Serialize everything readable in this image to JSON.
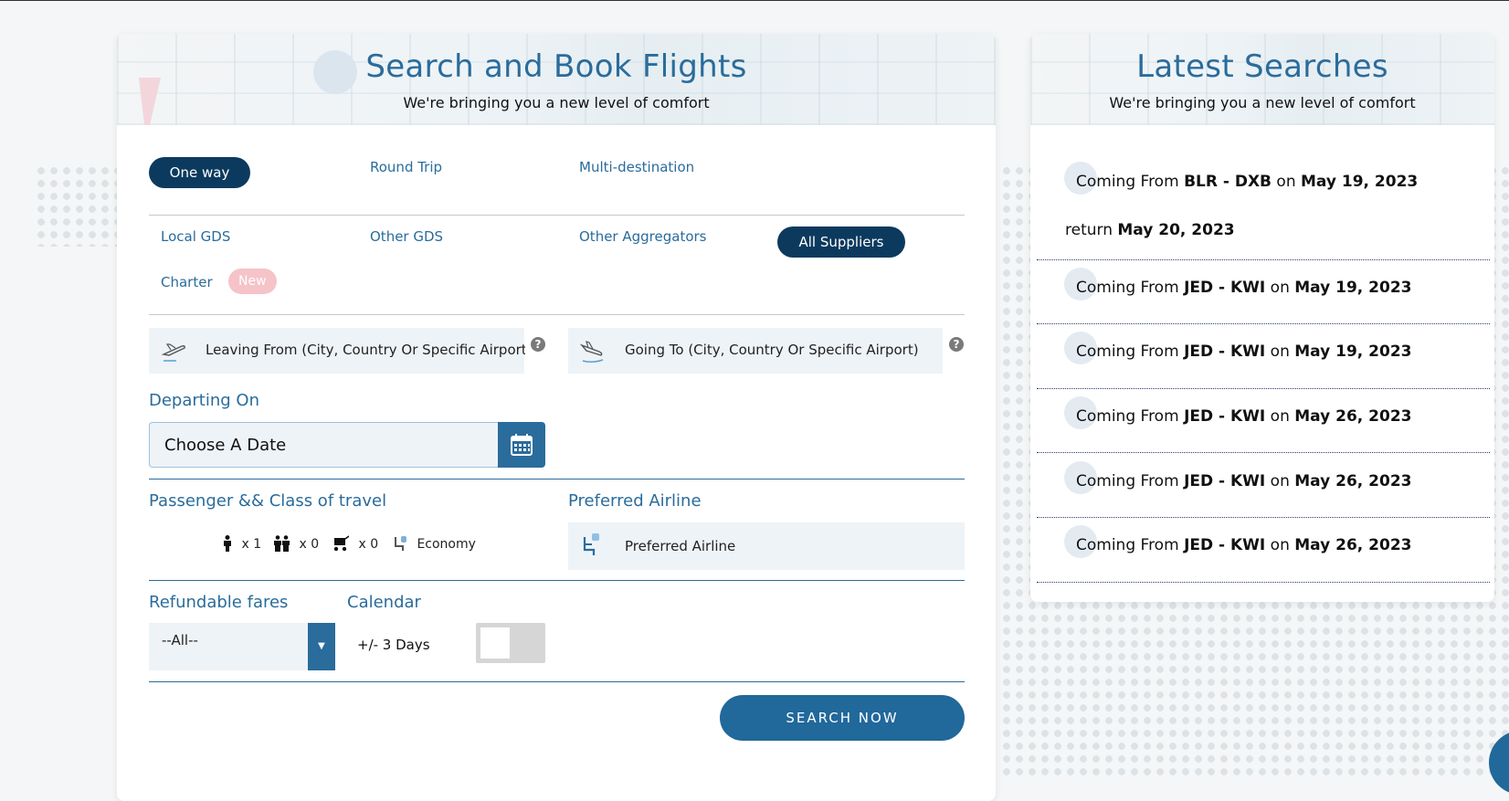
{
  "search_card": {
    "title": "Search and Book Flights",
    "subtitle": "We're bringing you a new level of comfort",
    "trip_types": [
      "One way",
      "Round Trip",
      "Multi-destination"
    ],
    "selected_trip_type": "One way",
    "suppliers": [
      "Local GDS",
      "Other GDS",
      "Other Aggregators",
      "All Suppliers",
      "Charter"
    ],
    "selected_supplier": "All Suppliers",
    "charter_badge": "New",
    "leaving_from": {
      "placeholder": "Leaving From (City, Country Or Specific Airport)"
    },
    "going_to": {
      "placeholder": "Going To (City, Country Or Specific Airport)"
    },
    "help_glyph": "?",
    "departing_label": "Departing On",
    "date_placeholder": "Choose A Date",
    "passenger_label": "Passenger && Class of travel",
    "adults": "x 1",
    "children": "x 0",
    "infants": "x 0",
    "travel_class": "Economy",
    "preferred_airline_label": "Preferred Airline",
    "preferred_airline_placeholder": "Preferred Airline",
    "refundable_label": "Refundable fares",
    "refundable_value": "--All--",
    "select_arrow": "▼",
    "calendar_label": "Calendar",
    "calendar_range": "+/- 3 Days",
    "calendar_toggle_on": false,
    "search_button": "SEARCH NOW"
  },
  "latest_card": {
    "title": "Latest Searches",
    "subtitle": "We're bringing you a new level of comfort",
    "items": [
      {
        "prefix": "Coming From",
        "route": "BLR - DXB",
        "on": "on",
        "date": "May 19, 2023",
        "return_prefix": "return",
        "return_date": "May 20, 2023"
      },
      {
        "prefix": "Coming From",
        "route": "JED - KWI",
        "on": "on",
        "date": "May 19, 2023"
      },
      {
        "prefix": "Coming From",
        "route": "JED - KWI",
        "on": "on",
        "date": "May 19, 2023"
      },
      {
        "prefix": "Coming From",
        "route": "JED - KWI",
        "on": "on",
        "date": "May 26, 2023"
      },
      {
        "prefix": "Coming From",
        "route": "JED - KWI",
        "on": "on",
        "date": "May 26, 2023"
      },
      {
        "prefix": "Coming From",
        "route": "JED - KWI",
        "on": "on",
        "date": "May 26, 2023"
      }
    ]
  },
  "icons": {
    "takeoff": "plane-takeoff-icon",
    "landing": "plane-landing-icon",
    "calendar": "calendar-icon",
    "adult": "adult-icon",
    "child": "children-icon",
    "infant": "stroller-icon",
    "seat": "seat-icon",
    "airline": "airline-seat-icon"
  },
  "colors": {
    "primary": "#2a6c9c",
    "dark_pill": "#0c3a5e",
    "badge": "#f5c3c8",
    "field_bg": "#eef3f7"
  }
}
